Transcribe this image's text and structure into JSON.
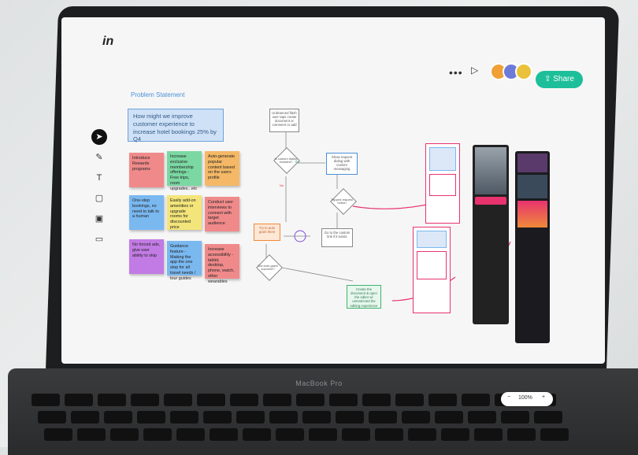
{
  "app": {
    "logo": "in",
    "brand_mark": "MacBook Pro"
  },
  "header": {
    "more_label": "•••",
    "play_label": "▷",
    "share_label": "Share",
    "share_color": "#1dbf9a",
    "avatars": [
      {
        "color": "#f0a037"
      },
      {
        "color": "#6c7bd8"
      },
      {
        "color": "#e9c23a"
      }
    ]
  },
  "tools": [
    {
      "name": "select",
      "glyph": "➤",
      "active": true
    },
    {
      "name": "pen",
      "glyph": "✎",
      "active": false
    },
    {
      "name": "text",
      "glyph": "T",
      "active": false
    },
    {
      "name": "shape",
      "glyph": "▢",
      "active": false
    },
    {
      "name": "image",
      "glyph": "▣",
      "active": false
    },
    {
      "name": "sticky",
      "glyph": "▭",
      "active": false
    }
  ],
  "board": {
    "problem_title": "Problem Statement",
    "problem_text": "How might we improve customer experience to increase hotel bookings 25% by Q4",
    "notes": [
      {
        "text": "Introduce Rewards programs",
        "color": "#f08a8a"
      },
      {
        "text": "Increase exclusive membership offerings - Free trips, room upgrades...etc",
        "color": "#7bd8a2"
      },
      {
        "text": "Auto-generate popular content based on the users profile",
        "color": "#f4b866"
      },
      {
        "text": "One-step bookings, no need to talk to a human",
        "color": "#7ab8f0"
      },
      {
        "text": "Easily add-on amenities or upgrade rooms for discounted price",
        "color": "#f3e57a"
      },
      {
        "text": "Conduct user interviews to connect with target audience",
        "color": "#f08a8a"
      },
      {
        "text": "No forced ads, give user ability to skip",
        "color": "#c27be4"
      },
      {
        "text": "Guidance feature - Making the app the one stop for all travel needs / tour guides",
        "color": "#7ab8f0"
      },
      {
        "text": "Increase accessibility - tablet, desktop, phone, watch, other wearables",
        "color": "#f08a8a"
      }
    ],
    "flow": {
      "start": "Unbranned flash user taps create document or comment or add",
      "decision1": "Is custom dialog enabled?",
      "yes": "Yes",
      "no": "No",
      "show_dialog": "Show request dialog with custom messaging",
      "decision2": "Tapped request button",
      "goto_custom": "Go to the custom link if it exists",
      "auto_grant": "Try to auto grant them",
      "decision3": "Did auto-grant succeed?",
      "create_doc": "Create the document & open the editor w/ unrestricted the editing experience"
    }
  },
  "footer": {
    "zoom_value": "100%",
    "zoom_minus": "−",
    "zoom_plus": "+",
    "help_glyph": "?"
  }
}
